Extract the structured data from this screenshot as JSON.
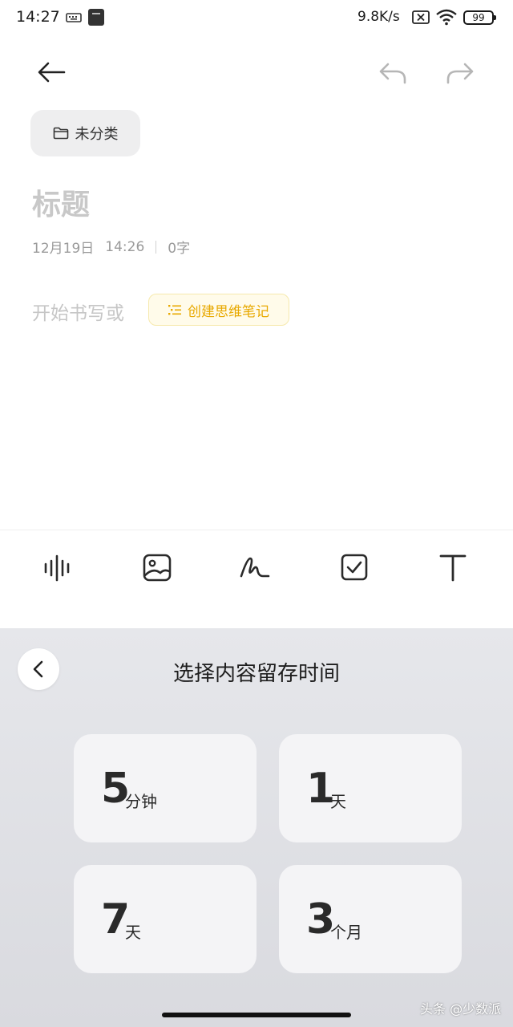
{
  "status_bar": {
    "time": "14:27",
    "net_speed": "9.8K/s",
    "battery": "99",
    "icons": [
      "keyboard-icon",
      "mi-app-icon",
      "sim-off-icon",
      "wifi-icon",
      "battery-icon"
    ]
  },
  "editor": {
    "category": "未分类",
    "title_placeholder": "标题",
    "date": "12月19日",
    "time": "14:26",
    "word_count": "0字",
    "body_placeholder": "开始书写或",
    "mindmap_label": "创建思维笔记"
  },
  "toolbar": {
    "tools": [
      "audio-wave-icon",
      "image-icon",
      "handwriting-icon",
      "checkbox-icon",
      "text-format-icon"
    ]
  },
  "retention_sheet": {
    "title": "选择内容留存时间",
    "options": [
      {
        "number": "5",
        "unit": "分钟"
      },
      {
        "number": "1",
        "unit": "天"
      },
      {
        "number": "7",
        "unit": "天"
      },
      {
        "number": "3",
        "unit": "个月"
      }
    ]
  },
  "watermark": "头条 @少数派",
  "colors": {
    "accent_yellow": "#e8a900",
    "placeholder_gray": "#c6c6c6",
    "sheet_bg": "#e0e1e5",
    "card_bg": "#f4f4f6"
  }
}
